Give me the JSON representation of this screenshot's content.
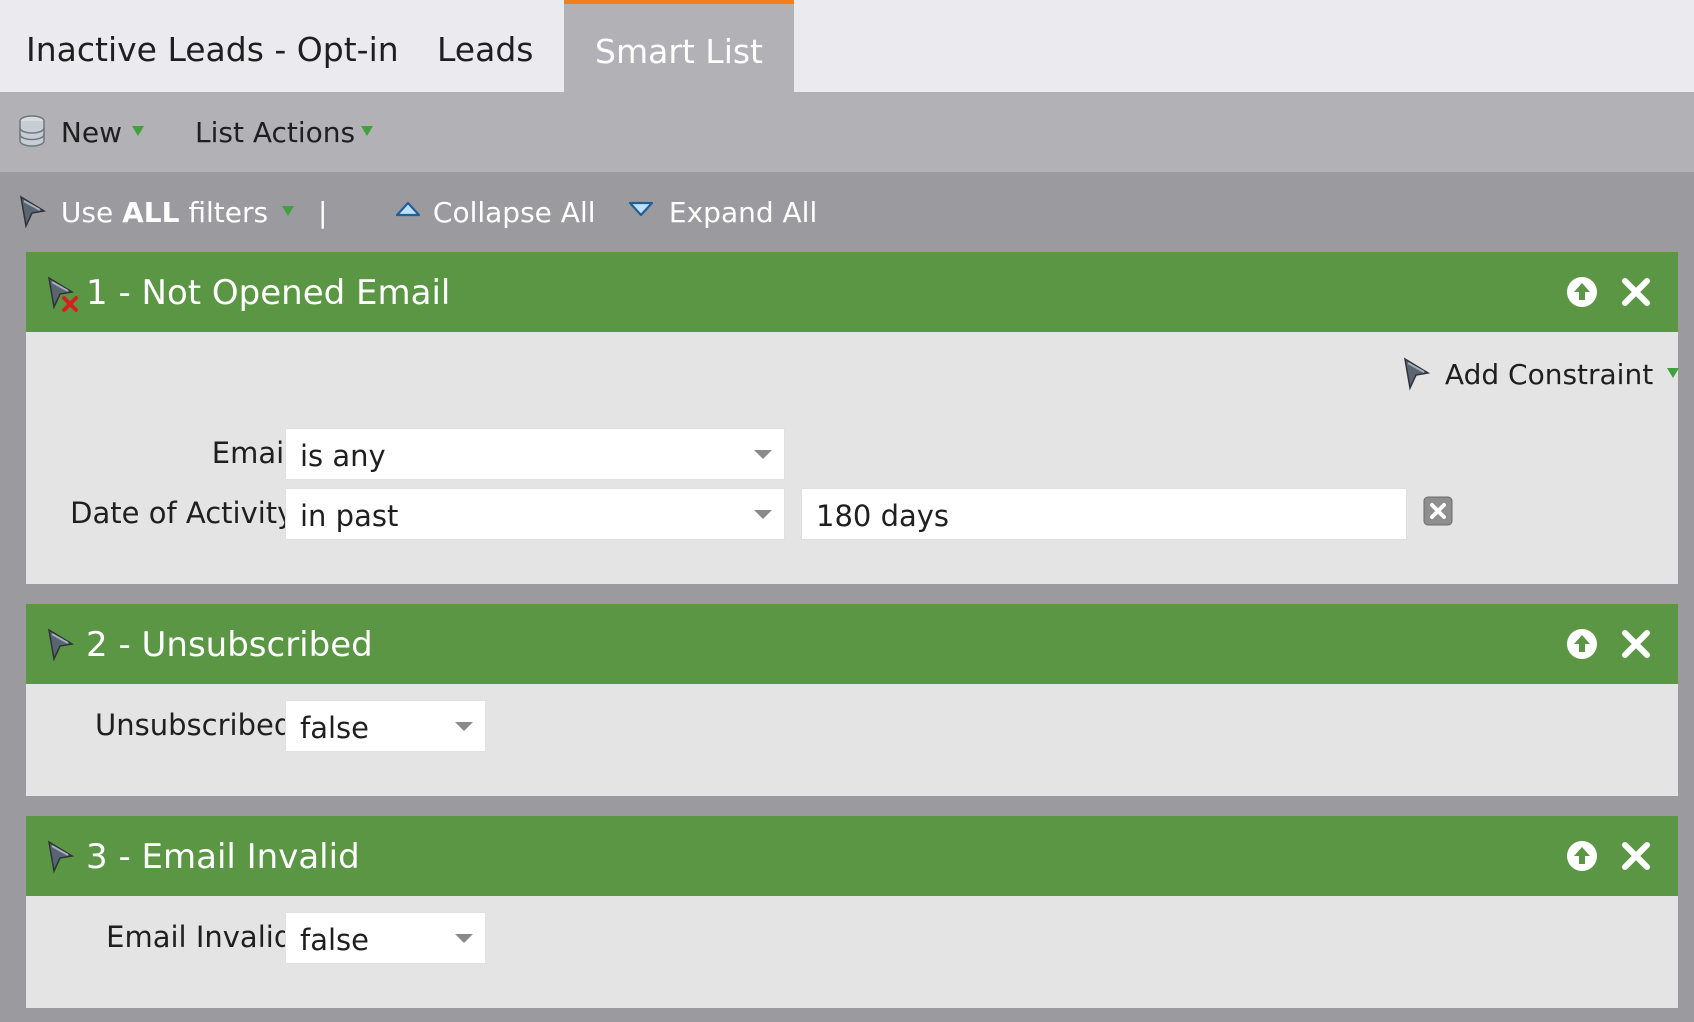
{
  "tabs": [
    {
      "label": "Inactive Leads - Opt-in",
      "active": false
    },
    {
      "label": "Leads",
      "active": false
    },
    {
      "label": "Smart List",
      "active": true
    }
  ],
  "toolbar": {
    "new_label": "New",
    "list_actions_label": "List Actions"
  },
  "filter_bar": {
    "use_prefix": "Use ",
    "use_bold": "ALL",
    "use_suffix": " filters",
    "separator": "|",
    "collapse_label": "Collapse All",
    "expand_label": "Expand All"
  },
  "filters": [
    {
      "title": "1 - Not Opened Email",
      "add_constraint_label": "Add Constraint",
      "rows": [
        {
          "label": "Email:",
          "operator": "is any"
        },
        {
          "label": "Date of Activity:",
          "operator": "in past",
          "value": "180 days"
        }
      ]
    },
    {
      "title": "2 - Unsubscribed",
      "rows": [
        {
          "label": "Unsubscribed:",
          "operator": "false"
        }
      ]
    },
    {
      "title": "3 - Email Invalid",
      "rows": [
        {
          "label": "Email Invalid:",
          "operator": "false"
        }
      ]
    }
  ],
  "colors": {
    "panel_header": "#5b9645",
    "active_tab_accent": "#f07f1f",
    "caret_green": "#3fa23f"
  },
  "icons": {
    "new": "database-icon",
    "filter": "funnel-icon",
    "collapse": "triangle-up-icon",
    "expand": "triangle-down-icon",
    "move_up": "arrow-up-circle-icon",
    "remove": "close-icon",
    "clear_value": "clear-box-icon"
  }
}
